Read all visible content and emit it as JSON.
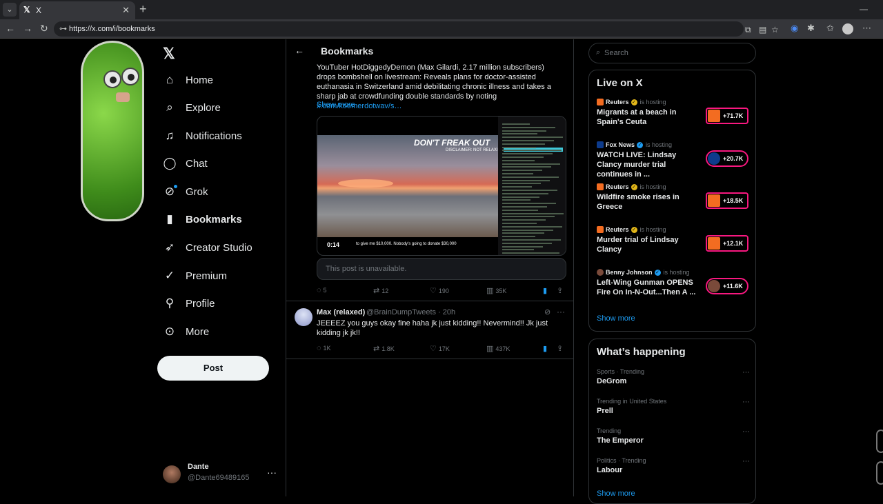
{
  "browser": {
    "tab_title": "X",
    "url": "https://x.com/i/bookmarks"
  },
  "nav": {
    "items": [
      {
        "label": "Home",
        "icon": "home-icon"
      },
      {
        "label": "Explore",
        "icon": "search-icon"
      },
      {
        "label": "Notifications",
        "icon": "bell-icon"
      },
      {
        "label": "Chat",
        "icon": "chat-icon"
      },
      {
        "label": "Grok",
        "icon": "grok-icon"
      },
      {
        "label": "Bookmarks",
        "icon": "bookmark-icon"
      },
      {
        "label": "Creator Studio",
        "icon": "rocket-icon"
      },
      {
        "label": "Premium",
        "icon": "verified-icon"
      },
      {
        "label": "Profile",
        "icon": "person-icon"
      },
      {
        "label": "More",
        "icon": "more-circle-icon"
      }
    ],
    "post_label": "Post"
  },
  "account": {
    "name": "Dante",
    "handle": "@Dante69489165"
  },
  "main": {
    "title": "Bookmarks",
    "tweet1": {
      "text": "YouTuber HotDiggedyDemon (Max Gilardi, 2.17 million subscribers) drops bombshell on livestream: Reveals plans for doctor-assisted euthanasia in Switzerland amid debilitating chronic illness and takes a sharp jab at crowdfunding double standards by noting ",
      "link": "x.com/koomerdotwav/s…",
      "show_more": "Show more",
      "media": {
        "overlay_title": "DON'T FREAK OUT",
        "overlay_sub": "DISCLAIMER: NOT RELAXING",
        "duration": "0:14",
        "caption": "to give me $10,000. Nobody's going to donate $30,000"
      },
      "quote_unavailable": "This post is unavailable.",
      "stats": {
        "replies": "5",
        "reposts": "12",
        "likes": "190",
        "views": "35K"
      }
    },
    "tweet2": {
      "name": "Max (relaxed)",
      "handle_time": "@BrainDumpTweets · 20h",
      "text": "JEEEEZ you guys okay fine haha jk just kidding!! Nevermind!! Jk just kidding jk jk!!",
      "stats": {
        "replies": "1K",
        "reposts": "1.8K",
        "likes": "17K",
        "views": "437K"
      }
    }
  },
  "right": {
    "search_placeholder": "Search",
    "live": {
      "title": "Live on X",
      "hosting_label": "is hosting",
      "items": [
        {
          "source": "Reuters",
          "title": "Migrants at a beach in Spain's Ceuta",
          "count": "+71.7K",
          "color": "#f36c21"
        },
        {
          "source": "Fox News",
          "title": "WATCH LIVE: Lindsay Clancy murder trial continues in ...",
          "count": "+20.7K",
          "color": "#0d3b8c"
        },
        {
          "source": "Reuters",
          "title": "Wildfire smoke rises in Greece",
          "count": "+18.5K",
          "color": "#f36c21"
        },
        {
          "source": "Reuters",
          "title": "Murder trial of Lindsay Clancy",
          "count": "+12.1K",
          "color": "#f36c21"
        },
        {
          "source": "Benny Johnson",
          "title": "Left-Wing Gunman OPENS Fire On In-N-Out...Then A ...",
          "count": "+11.6K",
          "color": "#7a4a3a"
        }
      ],
      "show_more": "Show more"
    },
    "trending": {
      "title": "What’s happening",
      "items": [
        {
          "category": "Sports · Trending",
          "name": "DeGrom"
        },
        {
          "category": "Trending in United States",
          "name": "Prell"
        },
        {
          "category": "Trending",
          "name": "The Emperor"
        },
        {
          "category": "Politics · Trending",
          "name": "Labour"
        }
      ],
      "show_more": "Show more"
    }
  }
}
